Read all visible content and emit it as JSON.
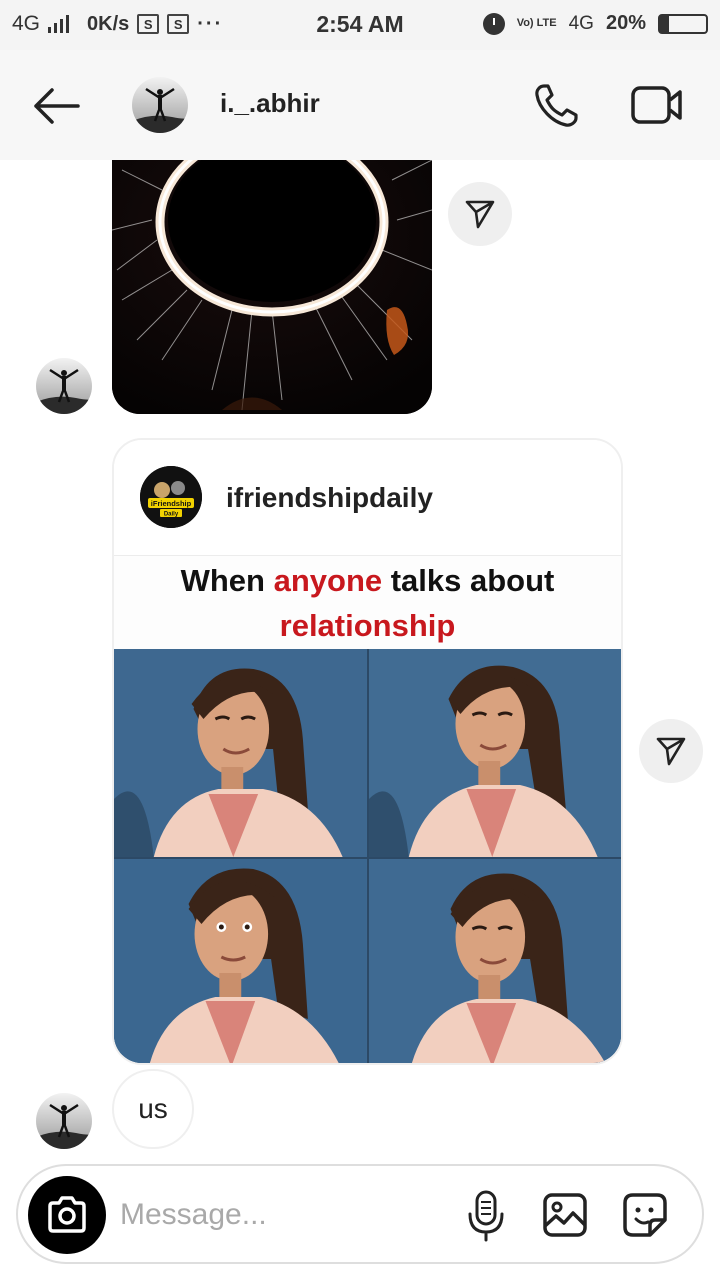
{
  "status_bar": {
    "network": "4G",
    "speed": "0K/s",
    "time": "2:54 AM",
    "volte": "Vo) LTE",
    "network_right": "4G",
    "battery_percent": "20%",
    "battery_level": 0.2,
    "box_icon_letter": "S",
    "more": "···"
  },
  "header": {
    "username": "i._.abhir"
  },
  "post": {
    "author": "ifriendshipdaily",
    "avatar_logo_text": "iFriendship",
    "avatar_logo_sub": "Daily",
    "caption_part1": "When ",
    "caption_highlight1": "anyone",
    "caption_part2": " talks about",
    "caption_highlight2": "relationship"
  },
  "messages": {
    "reply_text": "us"
  },
  "composer": {
    "placeholder": "Message..."
  },
  "colors": {
    "accent_red": "#c8181e",
    "header_bg": "#f7f7f7",
    "bubble_border": "#efefef"
  },
  "icons": [
    "back-arrow-icon",
    "phone-icon",
    "video-camera-icon",
    "send-icon",
    "camera-icon",
    "microphone-icon",
    "gallery-icon",
    "sticker-icon"
  ]
}
